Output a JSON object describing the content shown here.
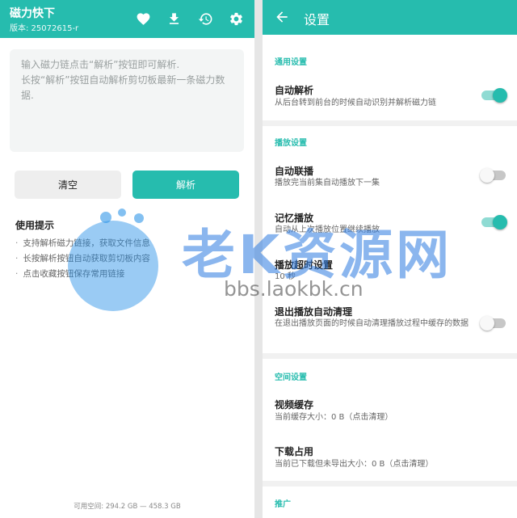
{
  "left": {
    "header": {
      "title": "磁力快下",
      "version": "版本: 25072615-r",
      "icons": [
        "heart-icon",
        "download-icon",
        "history-icon",
        "gear-icon"
      ]
    },
    "input": {
      "value": "",
      "placeholder": "输入磁力链点击“解析”按钮即可解析.\n长按“解析”按钮自动解析剪切板最新一条磁力数据."
    },
    "buttons": {
      "clear": "清空",
      "parse": "解析"
    },
    "tips": {
      "title": "使用提示",
      "items": [
        "支持解析磁力链接，获取文件信息",
        "长按解析按钮自动获取剪切板内容",
        "点击收藏按钮保存常用链接"
      ]
    },
    "storage": "可用空间: 294.2 GB — 458.3 GB"
  },
  "right": {
    "header": {
      "title": "设置",
      "icons": [
        "back-arrow-icon"
      ]
    },
    "sections": {
      "general": "通用设置",
      "playback": "播放设置",
      "space": "空间设置",
      "promo": "推广"
    },
    "settings": {
      "auto_parse": {
        "title": "自动解析",
        "desc": "从后台转到前台的时候自动识别并解析磁力链",
        "enabled": true
      },
      "auto_continue": {
        "title": "自动联播",
        "desc": "播放完当前集自动播放下一集",
        "enabled": false
      },
      "remember_play": {
        "title": "记忆播放",
        "desc": "自动从上次播放位置继续播放",
        "enabled": true
      },
      "play_timeout": {
        "title": "播放超时设置",
        "desc": "10 秒"
      },
      "exit_clean": {
        "title": "退出播放自动清理",
        "desc": "在退出播放页面的时候自动清理播放过程中缓存的数据",
        "enabled": false
      },
      "video_cache": {
        "title": "视频缓存",
        "desc": "当前缓存大小：0 B（点击清理）"
      },
      "download_usage": {
        "title": "下载占用",
        "desc": "当前已下载但未导出大小：0 B（点击清理）"
      }
    }
  },
  "watermark": {
    "text": "老K资源网",
    "url": "bbs.laokbk.cn"
  },
  "colors": {
    "accent": "#26bcae",
    "accent_light": "#8fdbd3",
    "watermark_blue": "#2b7ae0"
  }
}
